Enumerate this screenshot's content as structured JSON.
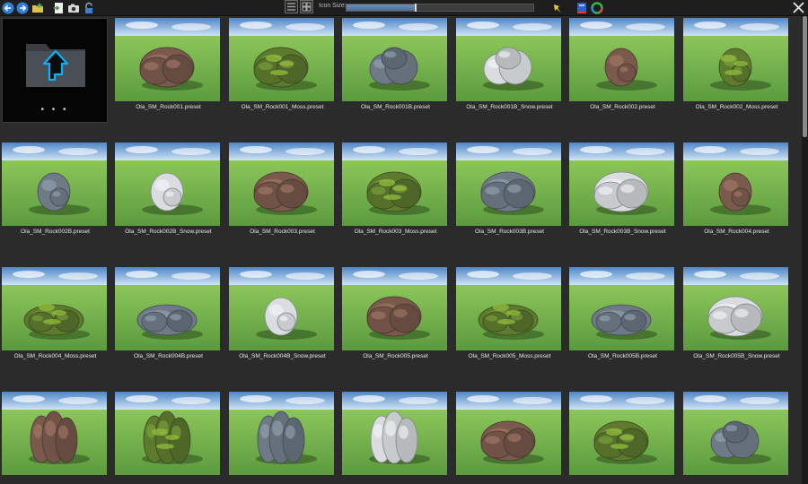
{
  "toolbar": {
    "icon_size_label": "Icon Size:",
    "icon_size_value": 0.37,
    "left_buttons": [
      "back-arrow-icon",
      "forward-arrow-icon",
      "favorite-folder-icon",
      "export-icon",
      "camera-icon",
      "lock-icon"
    ],
    "view_modes": [
      "list-view-icon",
      "grid-view-icon"
    ],
    "right_buttons": [
      "pin-icon",
      "blue-book-icon",
      "color-wheel-icon",
      "close-icon"
    ]
  },
  "folder_up": {
    "icon": "folder-up-icon",
    "dots": "• • •"
  },
  "items": [
    {
      "label": "Ola_SM_Rock001.preset",
      "tone": "brown",
      "shape": "mound"
    },
    {
      "label": "Ola_SM_Rock001_Moss.preset",
      "tone": "moss",
      "shape": "mound"
    },
    {
      "label": "Ola_SM_Rock001B.preset",
      "tone": "grey",
      "shape": "cluster"
    },
    {
      "label": "Ola_SM_Rock001B_Snow.preset",
      "tone": "snow",
      "shape": "cluster"
    },
    {
      "label": "Ola_SM_Rock002.preset",
      "tone": "brown",
      "shape": "small"
    },
    {
      "label": "Ola_SM_Rock002_Moss.preset",
      "tone": "moss",
      "shape": "small"
    },
    {
      "label": "Ola_SM_Rock002B.preset",
      "tone": "grey",
      "shape": "small"
    },
    {
      "label": "Ola_SM_Rock002B_Snow.preset",
      "tone": "snow",
      "shape": "small"
    },
    {
      "label": "Ola_SM_Rock003.preset",
      "tone": "brown",
      "shape": "mound"
    },
    {
      "label": "Ola_SM_Rock003_Moss.preset",
      "tone": "moss",
      "shape": "mound"
    },
    {
      "label": "Ola_SM_Rock003B.preset",
      "tone": "grey",
      "shape": "mound"
    },
    {
      "label": "Ola_SM_Rock003B_Snow.preset",
      "tone": "snow",
      "shape": "mound"
    },
    {
      "label": "Ola_SM_Rock004.preset",
      "tone": "brown",
      "shape": "small"
    },
    {
      "label": "Ola_SM_Rock004_Moss.preset",
      "tone": "moss",
      "shape": "flat"
    },
    {
      "label": "Ola_SM_Rock004B.preset",
      "tone": "grey",
      "shape": "flat"
    },
    {
      "label": "Ola_SM_Rock004B_Snow.preset",
      "tone": "snow",
      "shape": "small"
    },
    {
      "label": "Ola_SM_Rock005.preset",
      "tone": "brown",
      "shape": "mound"
    },
    {
      "label": "Ola_SM_Rock005_Moss.preset",
      "tone": "moss",
      "shape": "flat"
    },
    {
      "label": "Ola_SM_Rock005B.preset",
      "tone": "grey",
      "shape": "flat"
    },
    {
      "label": "Ola_SM_Rock005B_Snow.preset",
      "tone": "snow",
      "shape": "mound"
    },
    {
      "label": "",
      "tone": "brown",
      "shape": "tall"
    },
    {
      "label": "",
      "tone": "moss",
      "shape": "tall"
    },
    {
      "label": "",
      "tone": "grey",
      "shape": "tall"
    },
    {
      "label": "",
      "tone": "snow",
      "shape": "tall"
    },
    {
      "label": "",
      "tone": "brown",
      "shape": "mound"
    },
    {
      "label": "",
      "tone": "moss",
      "shape": "mound"
    },
    {
      "label": "",
      "tone": "grey",
      "shape": "cluster"
    }
  ],
  "colors": {
    "sky_top": "#4f86c6",
    "sky_bottom": "#cfe3f5",
    "grass_top": "#8cc65a",
    "grass_bottom": "#5b9a3e",
    "brown": "#7a5a4c",
    "moss": "#5d7a2e",
    "grey": "#6e7a86",
    "snow": "#d9dde0",
    "accent": "#00b4ff"
  }
}
